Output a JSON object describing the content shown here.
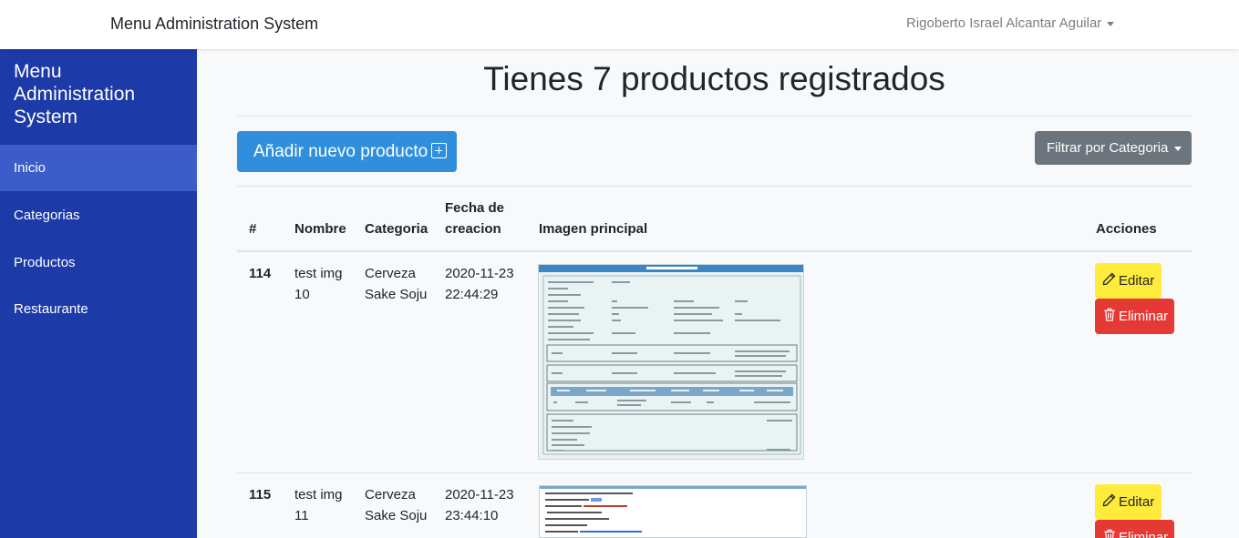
{
  "navbar": {
    "brand": "Menu Administration System",
    "user": "Rigoberto Israel Alcantar Aguilar"
  },
  "sidebar": {
    "title": "Menu Administration System",
    "items": [
      {
        "label": "Inicio",
        "active": true
      },
      {
        "label": "Categorias",
        "active": false
      },
      {
        "label": "Productos",
        "active": false
      },
      {
        "label": "Restaurante",
        "active": false
      }
    ]
  },
  "main": {
    "title": "Tienes 7 productos registrados",
    "add_button": "Añadir nuevo producto",
    "filter_button": "Filtrar por Categoria"
  },
  "table": {
    "headers": [
      "#",
      "Nombre",
      "Categoria",
      "Fecha de creacion",
      "Imagen principal",
      "Acciones"
    ],
    "rows": [
      {
        "id": "114",
        "name": "test img 10",
        "category": "Cerveza Sake Soju",
        "date": "2020-11-23 22:44:29",
        "edit": "Editar",
        "delete": "Eliminar"
      },
      {
        "id": "115",
        "name": "test img 11",
        "category": "Cerveza Sake Soju",
        "date": "2020-11-23 23:44:10",
        "edit": "Editar",
        "delete": "Eliminar"
      }
    ]
  },
  "colors": {
    "sidebar": "#1c3aa8",
    "sidebar_active": "#3b5cc9",
    "primary": "#2f8fdc",
    "secondary": "#6c757d",
    "warning": "#ffeb3b",
    "danger": "#e53935"
  },
  "icons": {
    "add": "plus-square-icon",
    "edit": "pencil-icon",
    "delete": "trash-icon"
  }
}
